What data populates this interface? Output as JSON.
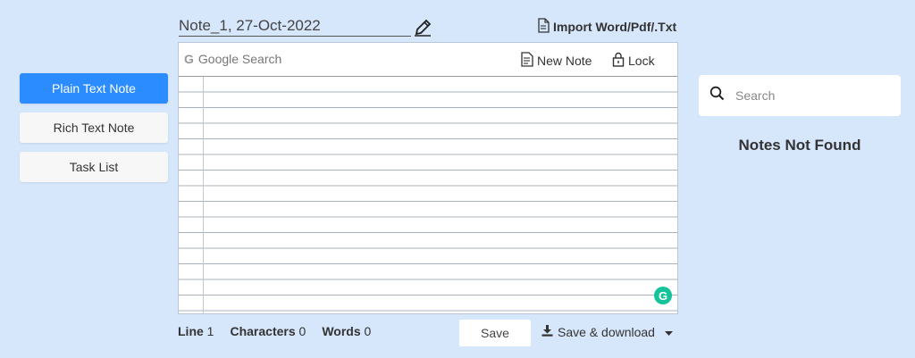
{
  "nav": {
    "items": [
      {
        "label": "Plain Text Note",
        "active": true
      },
      {
        "label": "Rich Text Note",
        "active": false
      },
      {
        "label": "Task List",
        "active": false
      }
    ]
  },
  "note": {
    "title": "Note_1, 27-Oct-2022",
    "import_label": "Import Word/Pdf/.Txt"
  },
  "toolbar": {
    "google_search": "Google Search",
    "new_note": "New Note",
    "lock": "Lock"
  },
  "grammarly": {
    "letter": "G"
  },
  "stats": {
    "line_label": "Line",
    "line_value": "1",
    "chars_label": "Characters",
    "chars_value": "0",
    "words_label": "Words",
    "words_value": "0"
  },
  "actions": {
    "save": "Save",
    "save_download": "Save & download"
  },
  "sidebar_search": {
    "placeholder": "Search",
    "empty_message": "Notes Not Found"
  },
  "colors": {
    "background": "#d6e6fb",
    "accent": "#2a8cff",
    "grammarly": "#15c39a"
  }
}
